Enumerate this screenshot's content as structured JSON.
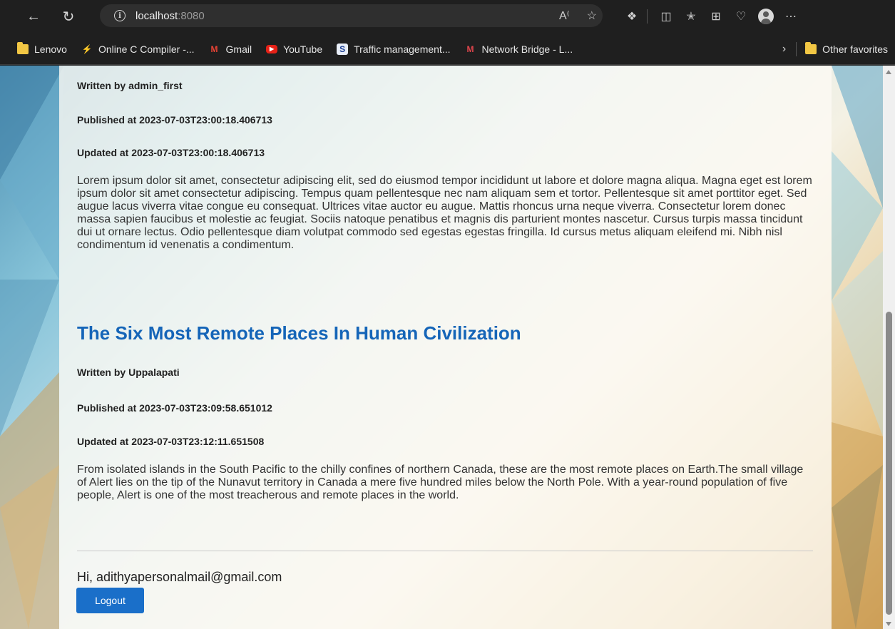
{
  "browser": {
    "url_host": "localhost",
    "url_port": ":8080",
    "bookmarks": [
      {
        "label": "Lenovo",
        "icon": "folder-icon"
      },
      {
        "label": "Online C Compiler -...",
        "icon": "lightning-icon"
      },
      {
        "label": "Gmail",
        "icon": "gmail-icon"
      },
      {
        "label": "YouTube",
        "icon": "youtube-icon"
      },
      {
        "label": "Traffic management...",
        "icon": "site-s-icon"
      },
      {
        "label": "Network Bridge - L...",
        "icon": "site-m-icon"
      }
    ],
    "other_favorites": "Other favorites"
  },
  "posts": [
    {
      "author": "Written by admin_first",
      "published": "Published at 2023-07-03T23:00:18.406713",
      "updated": "Updated at 2023-07-03T23:00:18.406713",
      "body": "Lorem ipsum dolor sit amet, consectetur adipiscing elit, sed do eiusmod tempor incididunt ut labore et dolore magna aliqua. Magna eget est lorem ipsum dolor sit amet consectetur adipiscing. Tempus quam pellentesque nec nam aliquam sem et tortor. Pellentesque sit amet porttitor eget. Sed augue lacus viverra vitae congue eu consequat. Ultrices vitae auctor eu augue. Mattis rhoncus urna neque viverra. Consectetur lorem donec massa sapien faucibus et molestie ac feugiat. Sociis natoque penatibus et magnis dis parturient montes nascetur. Cursus turpis massa tincidunt dui ut ornare lectus. Odio pellentesque diam volutpat commodo sed egestas egestas fringilla. Id cursus metus aliquam eleifend mi. Nibh nisl condimentum id venenatis a condimentum."
    },
    {
      "title": "The Six Most Remote Places In Human Civilization",
      "author": "Written by Uppalapati",
      "published": "Published at 2023-07-03T23:09:58.651012",
      "updated": "Updated at 2023-07-03T23:12:11.651508",
      "body": "From isolated islands in the South Pacific to the chilly confines of northern Canada, these are the most remote places on Earth.The small village of Alert lies on the tip of the Nunavut territory in Canada a mere five hundred miles below the North Pole. With a year-round population of five people, Alert is one of the most treacherous and remote places in the world."
    }
  ],
  "footer": {
    "greeting": "Hi, adithyapersonalmail@gmail.com",
    "logout_label": "Logout"
  },
  "colors": {
    "title_blue": "#1565b8",
    "button_blue": "#1a6fc9",
    "chrome_dark": "#1f1f1f"
  }
}
